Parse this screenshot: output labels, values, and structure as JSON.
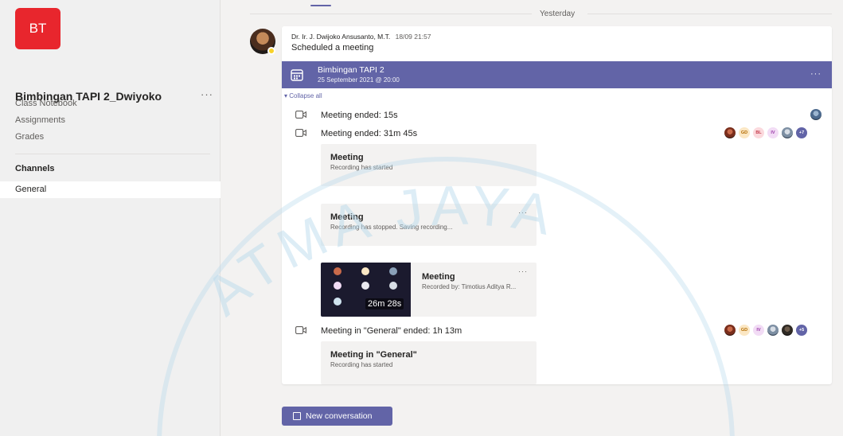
{
  "sidebar": {
    "team_initials": "BT",
    "team_name": "Bimbingan TAPI 2_Dwiyoko",
    "more": "···",
    "nav": [
      "Class Notebook",
      "Assignments",
      "Grades"
    ],
    "channels_heading": "Channels",
    "channels": [
      "General"
    ]
  },
  "feed": {
    "day_separator": "Yesterday",
    "post": {
      "author": "Dr. Ir. J. Dwijoko Ansusanto, M.T.",
      "timestamp": "18/09 21:57",
      "text": "Scheduled a meeting",
      "meeting": {
        "title": "Bimbingan TAPI 2",
        "datetime": "25 September 2021 @ 20:00",
        "more": "···"
      },
      "collapse_label": "Collapse all",
      "events": [
        {
          "text": "Meeting ended: 15s"
        },
        {
          "text": "Meeting ended: 31m 45s",
          "participants": [
            "GD",
            "BL",
            "IV"
          ],
          "more_count": "+7"
        },
        {
          "text": "Meeting in \"General\" ended: 1h 13m",
          "participants": [
            "GD",
            "IV"
          ],
          "more_count": "+5"
        }
      ],
      "cards": [
        {
          "title": "Meeting",
          "desc": "Recording has started"
        },
        {
          "title": "Meeting",
          "desc": "Recording has stopped. Saving recording...",
          "more": "···"
        },
        {
          "title": "Meeting in \"General\"",
          "desc": "Recording has started"
        }
      ],
      "recording": {
        "title": "Meeting",
        "recorded_by": "Recorded by: Timotius Aditya R...",
        "duration": "26m 28s",
        "more": "···"
      }
    }
  },
  "compose": {
    "new_conversation": "New conversation"
  },
  "watermark": {
    "text": "ATMA JAYA"
  },
  "colors": {
    "accent": "#6264a7",
    "team_tile": "#e8262d",
    "presence": "#f8d22a",
    "watermark": "#b3d7ea"
  }
}
